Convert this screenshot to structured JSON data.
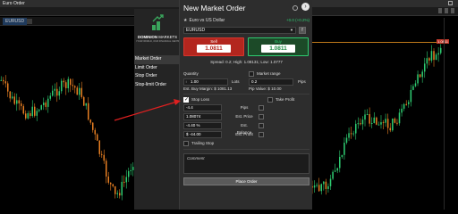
{
  "app": {
    "top_tab_label": "Euro Order",
    "chart_symbol": "EURUSD",
    "price_tag": "1.0811"
  },
  "logo": {
    "name_bold": "DOMINION",
    "name_thin": " MARKETS",
    "tagline": "YOUR WORLD, OUR FINANCIAL CENTRE"
  },
  "sidebar": {
    "items": [
      {
        "label": "Market Order",
        "active": true
      },
      {
        "label": "Limit Order",
        "active": false
      },
      {
        "label": "Stop Order",
        "active": false
      },
      {
        "label": "Stop-limit Order",
        "active": false
      }
    ]
  },
  "panel": {
    "title": "New Market Order",
    "instrument_name": "Euro vs US Dollar",
    "change": "+0.0 (+0.2%)",
    "symbol_value": "EURUSD",
    "sell": {
      "label": "Sell",
      "price": "1.0811"
    },
    "buy": {
      "label": "Buy",
      "price": "1.0811"
    },
    "spread_text": "Spread: 0.2; High: 1.08131; Low: 1.0777"
  },
  "quantity": {
    "label": "Quantity",
    "value": "1.00",
    "unit": "Lots",
    "margin_text": "Est. Buy Margin: $ 1081.13",
    "market_range_label": "Market range",
    "range_value": "0.2",
    "range_unit": "Pips",
    "pip_value_text": "Pip Value: $ 10.00"
  },
  "stop_loss": {
    "label": "Stop Loss",
    "checked": true,
    "take_profit_label": "Take Profit",
    "rows": [
      {
        "value": "-4.4",
        "label": "Pips"
      },
      {
        "value": "1.08074",
        "label": "Est. Price"
      },
      {
        "value": "-4.40 %",
        "label": "Est. Balance"
      },
      {
        "value": "$ -44.00",
        "label": "Est. Profit"
      }
    ],
    "trailing_label": "Trailing Stop"
  },
  "comment": {
    "placeholder": "Comment"
  },
  "place_order_label": "Place Order",
  "colors": {
    "sell": "#b3261e",
    "buy": "#2ecc71",
    "price_line": "#c17a1a",
    "arrow": "#e02020"
  }
}
